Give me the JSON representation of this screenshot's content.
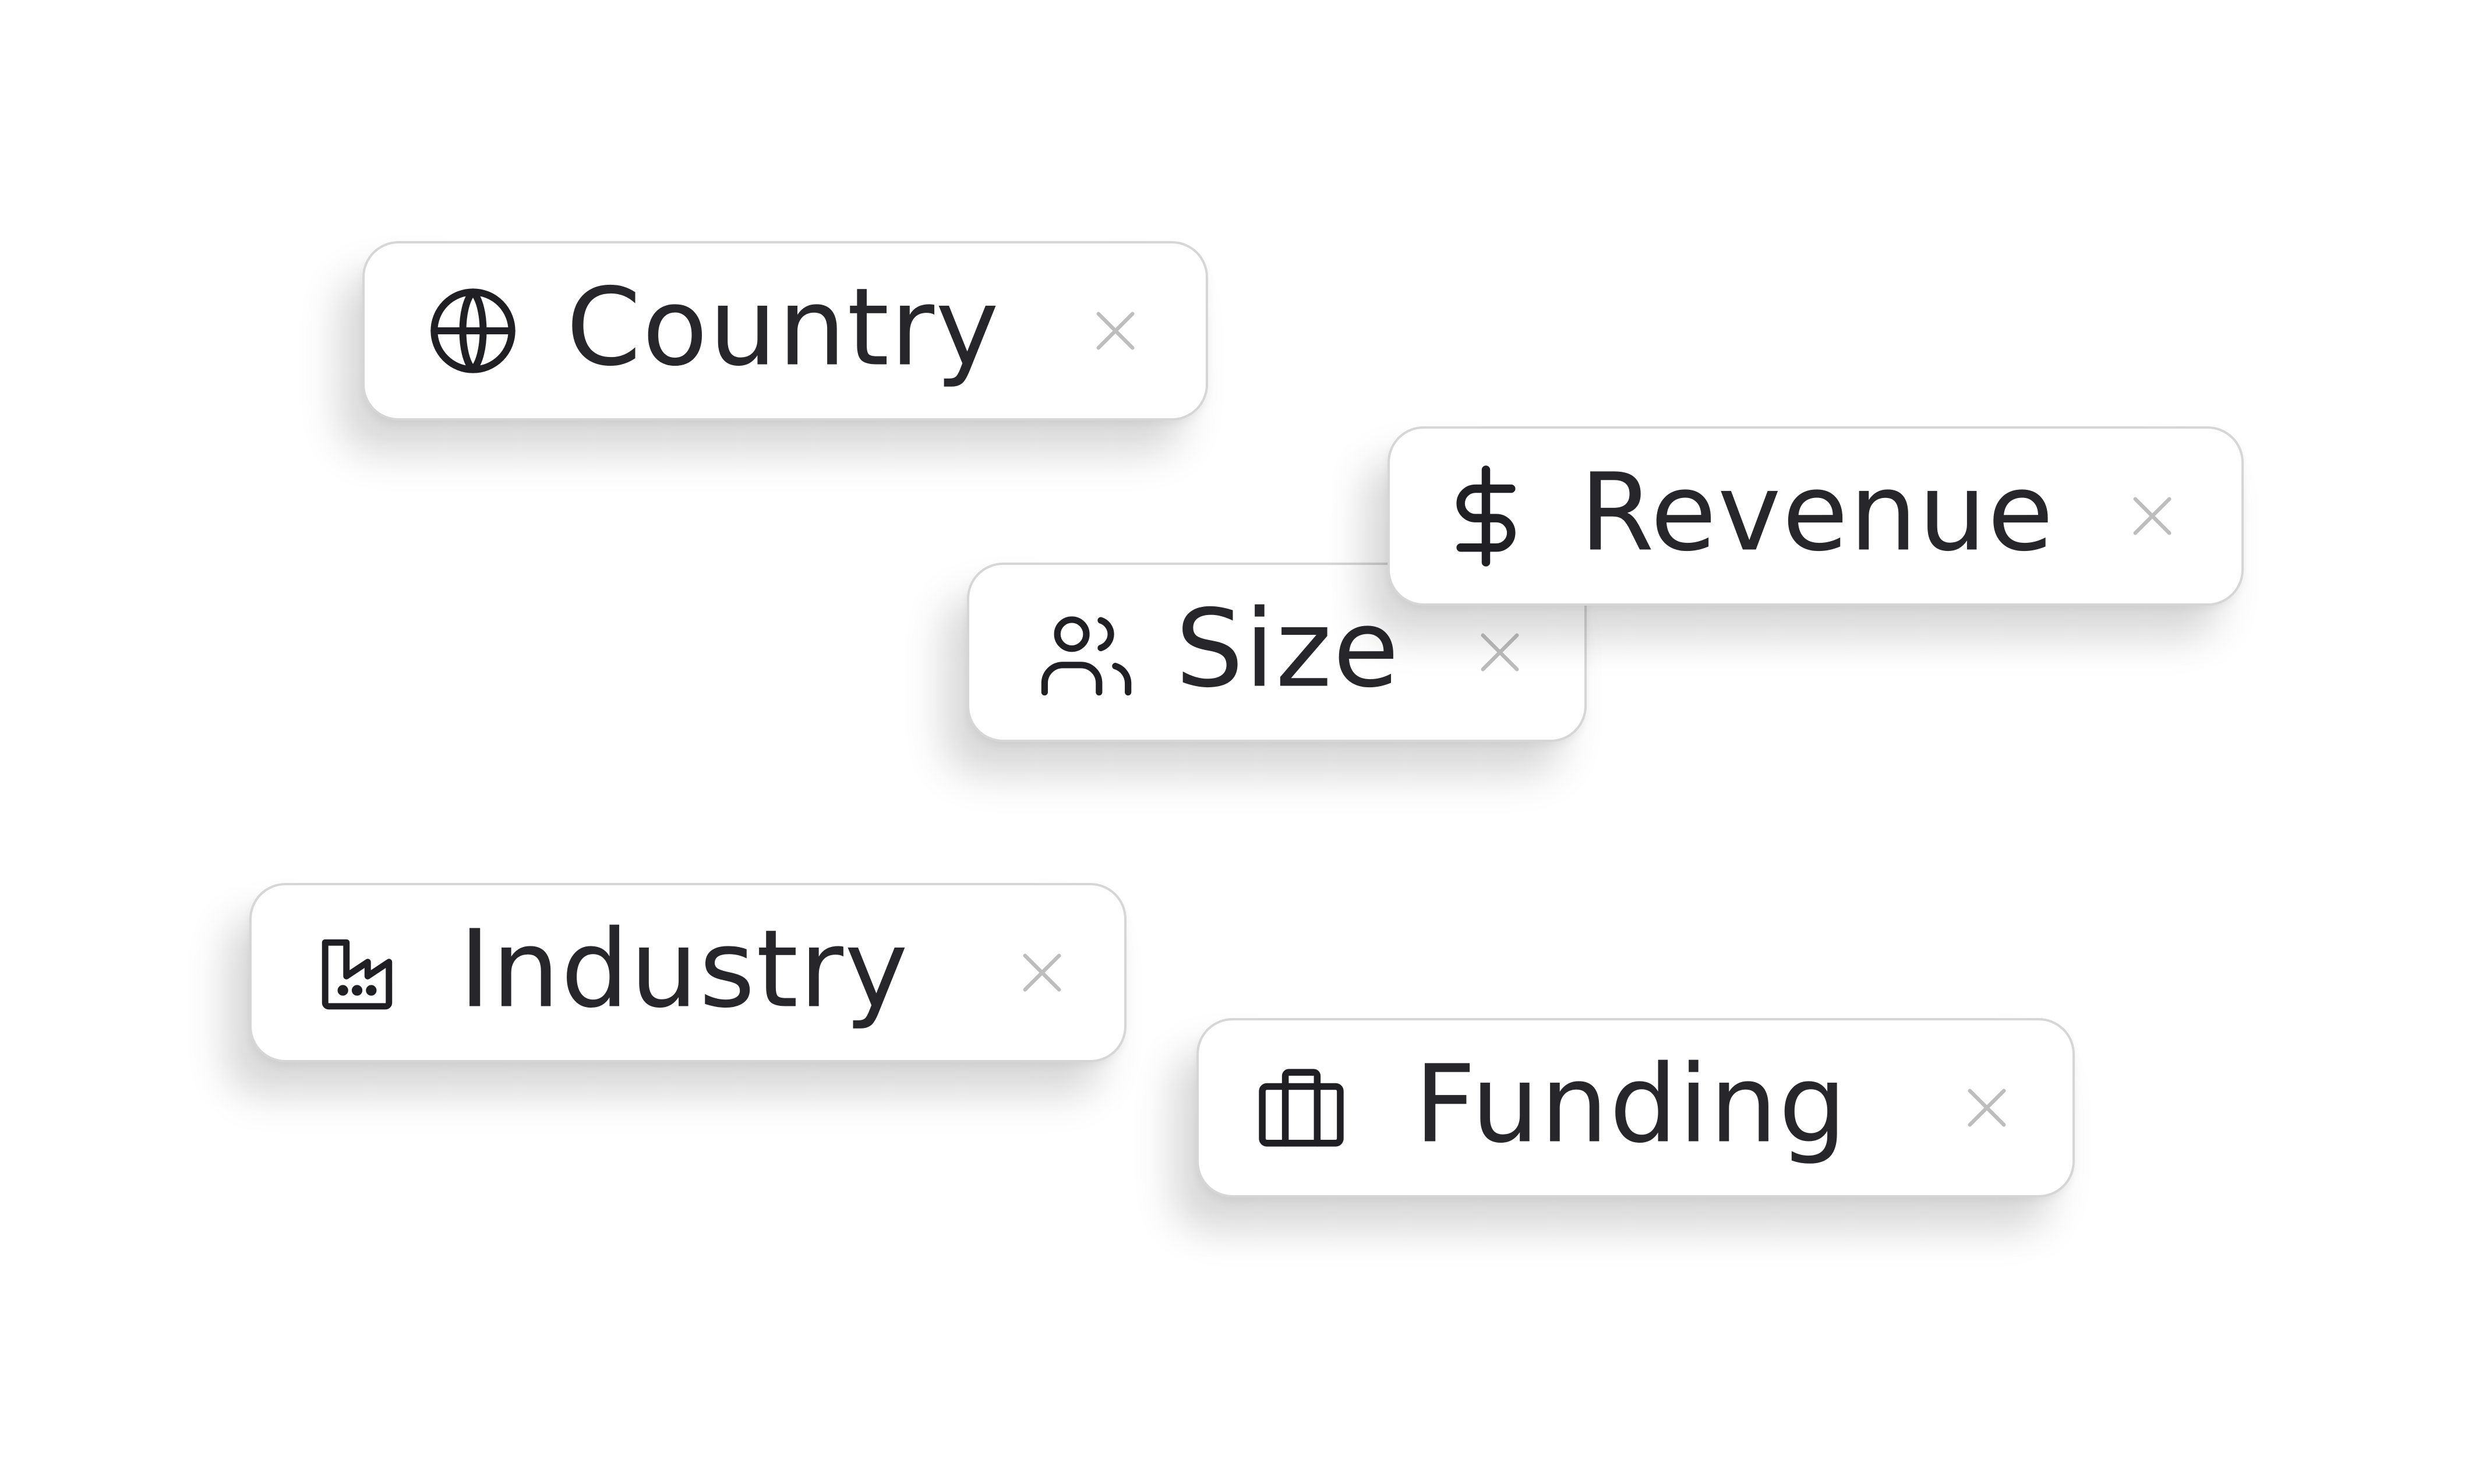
{
  "filters": [
    {
      "id": "country",
      "label": "Country",
      "icon": "globe-icon"
    },
    {
      "id": "revenue",
      "label": "Revenue",
      "icon": "dollar-icon"
    },
    {
      "id": "size",
      "label": "Size",
      "icon": "users-icon"
    },
    {
      "id": "industry",
      "label": "Industry",
      "icon": "factory-icon"
    },
    {
      "id": "funding",
      "label": "Funding",
      "icon": "briefcase-icon"
    }
  ],
  "colors": {
    "text": "#26262b",
    "icon": "#1f1f24",
    "close": "#bdbdbd",
    "border": "#d6d6d6",
    "background": "#ffffff"
  }
}
